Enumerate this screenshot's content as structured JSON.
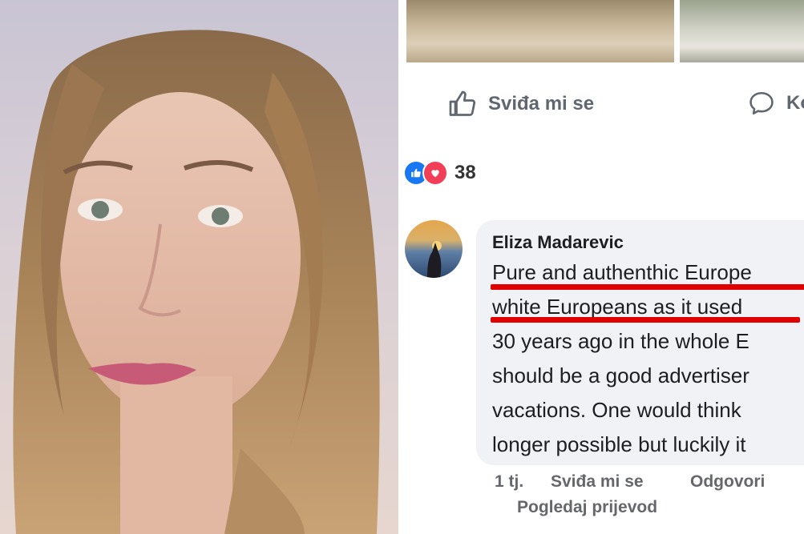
{
  "post": {
    "like_label": "Sviđa mi se",
    "comment_label_partial": "Ko",
    "reaction_count": "38"
  },
  "comment": {
    "author": "Eliza Madarevic",
    "lines": [
      "Pure and authenthic Europe",
      "white Europeans as it used",
      "30 years ago in the whole E",
      "should be a good advertiser",
      "vacations. One would think",
      "longer possible but luckily it"
    ],
    "time": "1 tj.",
    "like_label": "Sviđa mi se",
    "reply_label": "Odgovori",
    "translate_label": "Pogledaj prijevod"
  },
  "colors": {
    "highlight_red": "#e10000",
    "fb_blue": "#1877f2",
    "love_red": "#f33e58",
    "bubble_bg": "#f0f2f5"
  },
  "icons": [
    "thumbs-up-icon",
    "comment-icon",
    "like-reaction-icon",
    "love-reaction-icon"
  ]
}
